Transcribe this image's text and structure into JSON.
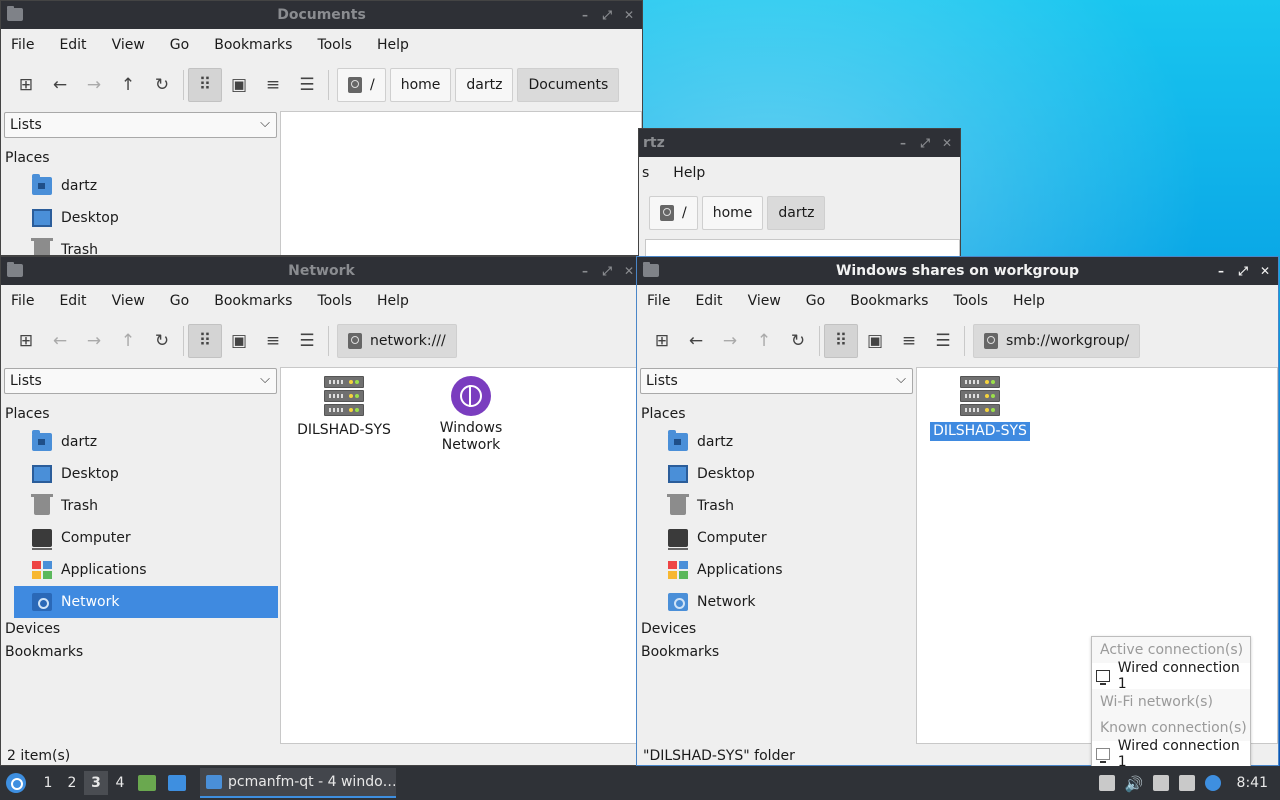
{
  "menu": [
    "File",
    "Edit",
    "View",
    "Go",
    "Bookmarks",
    "Tools",
    "Help"
  ],
  "windows": {
    "documents": {
      "title": "Documents",
      "path": [
        "/",
        "home",
        "dartz",
        "Documents"
      ],
      "side_mode": "Lists",
      "places_label": "Places",
      "places": [
        "dartz",
        "Desktop",
        "Trash"
      ]
    },
    "dartz": {
      "title_partial": "rtz",
      "menu_partial": [
        "s",
        "Help"
      ],
      "path": [
        "/",
        "home",
        "dartz"
      ]
    },
    "network": {
      "title": "Network",
      "path": [
        "network:///"
      ],
      "side_mode": "Lists",
      "places_label": "Places",
      "places": [
        "dartz",
        "Desktop",
        "Trash",
        "Computer",
        "Applications",
        "Network"
      ],
      "devices_label": "Devices",
      "bookmarks_label": "Bookmarks",
      "items": [
        "DILSHAD-SYS",
        "Windows Network"
      ],
      "status": "2 item(s)"
    },
    "smb": {
      "title": "Windows shares on workgroup",
      "path": [
        "smb://workgroup/"
      ],
      "side_mode": "Lists",
      "places_label": "Places",
      "places": [
        "dartz",
        "Desktop",
        "Trash",
        "Computer",
        "Applications",
        "Network"
      ],
      "devices_label": "Devices",
      "bookmarks_label": "Bookmarks",
      "items": [
        "DILSHAD-SYS"
      ],
      "status": "\"DILSHAD-SYS\" folder"
    }
  },
  "network_popup": {
    "active_header": "Active connection(s)",
    "active_item": "Wired connection 1",
    "wifi_header": "Wi-Fi network(s)",
    "known_header": "Known connection(s)",
    "known_item": "Wired connection 1"
  },
  "taskbar": {
    "workspaces": [
      "1",
      "2",
      "3",
      "4"
    ],
    "active_workspace": "3",
    "task_label": "pcmanfm-qt - 4 windo…",
    "clock": "8:41"
  },
  "colors": {
    "accent": "#3f8ae0",
    "titlebar": "#2e3036",
    "panel": "#2f3237"
  }
}
